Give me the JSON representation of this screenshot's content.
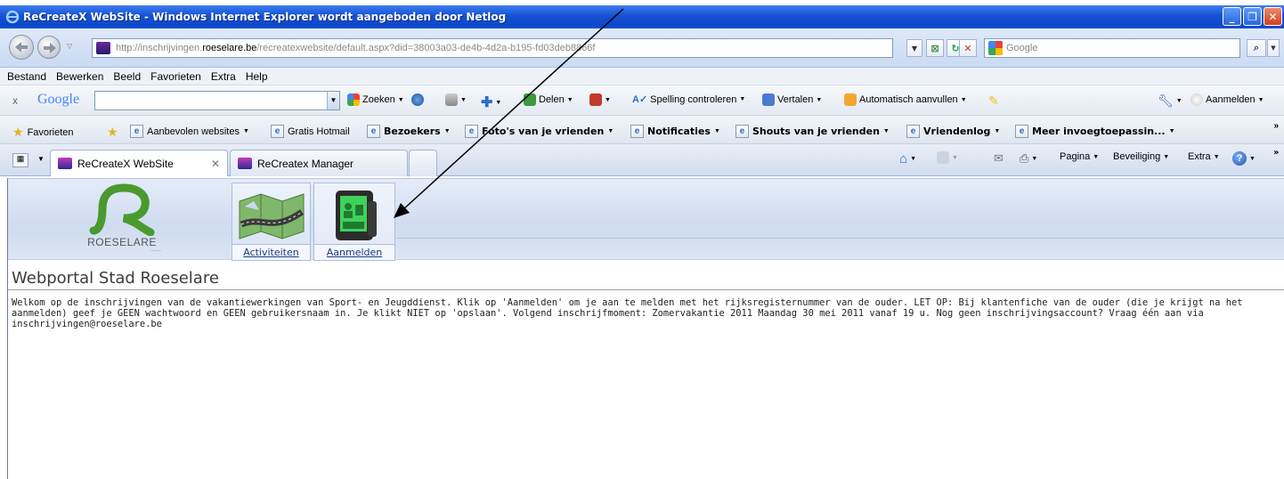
{
  "window": {
    "title": "ReCreateX WebSite - Windows Internet Explorer wordt aangeboden door Netlog",
    "controls": [
      "_",
      "❐",
      "✕"
    ]
  },
  "address_bar": {
    "url_prefix": "http://inschrijvingen.",
    "url_host": "roeselare.be",
    "url_path": "/recreatexwebsite/default.aspx?did=38003a03-de4b-4d2a-b195-fd03deb8866f",
    "search_placeholder": "Google"
  },
  "menu": {
    "items": [
      "Bestand",
      "Bewerken",
      "Beeld",
      "Favorieten",
      "Extra",
      "Help"
    ]
  },
  "google_toolbar": {
    "logo": "Google",
    "search": "Zoeken",
    "share": "Delen",
    "spelling": "Spelling controleren",
    "translate": "Vertalen",
    "autofill": "Automatisch aanvullen",
    "signin": "Aanmelden"
  },
  "favorites_bar": {
    "favorites": "Favorieten",
    "items": [
      {
        "label": "Aanbevolen websites",
        "bold": false,
        "dropdown": true
      },
      {
        "label": "Gratis Hotmail",
        "bold": false,
        "dropdown": false
      },
      {
        "label": "Bezoekers",
        "bold": true,
        "dropdown": true
      },
      {
        "label": "Foto's van je vrienden",
        "bold": true,
        "dropdown": true
      },
      {
        "label": "Notificaties",
        "bold": true,
        "dropdown": true
      },
      {
        "label": "Shouts van je vrienden",
        "bold": true,
        "dropdown": true
      },
      {
        "label": "Vriendenlog",
        "bold": true,
        "dropdown": true
      },
      {
        "label": "Meer invoegtoepassin...",
        "bold": true,
        "dropdown": true
      }
    ]
  },
  "tabs": [
    {
      "label": "ReCreateX WebSite",
      "active": true
    },
    {
      "label": "ReCreatex Manager",
      "active": false
    }
  ],
  "command_bar": {
    "page": "Pagina",
    "security": "Beveiliging",
    "extra": "Extra"
  },
  "site": {
    "logo_text": "ROESELARE",
    "nav": [
      {
        "label": "Activiteiten",
        "icon": "map-icon"
      },
      {
        "label": "Aanmelden",
        "icon": "id-card-reader-icon"
      }
    ],
    "portal_title": "Webportal Stad Roeselare",
    "intro": "Welkom op de inschrijvingen van de vakantiewerkingen van Sport- en Jeugddienst. Klik op 'Aanmelden' om je aan te melden met het rijksregisternummer van de ouder. LET OP: Bij klantenfiche van de ouder (die je krijgt na het aanmelden) geef je GEEN wachtwoord en GEEN gebruikersnaam in. Je klikt NIET op 'opslaan'. Volgend inschrijfmoment: Zomervakantie 2011 Maandag 30 mei 2011 vanaf 19 u. Nog geen inschrijvingsaccount? Vraag één aan via inschrijvingen@roeselare.be"
  },
  "colors": {
    "titlebar": "#0c47c8",
    "link": "#1a3a8a",
    "logo_green": "#4a9a2e"
  }
}
